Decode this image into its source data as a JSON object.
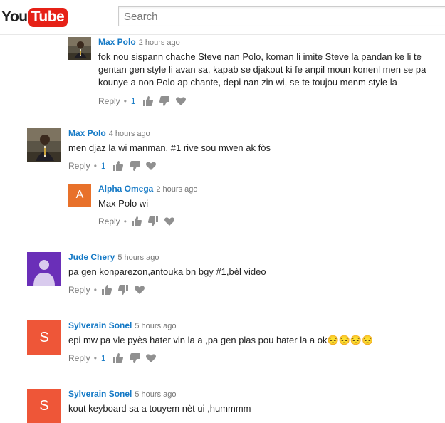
{
  "header": {
    "logo_you": "You",
    "logo_tube": "Tube",
    "search_placeholder": "Search"
  },
  "comments": [
    {
      "author": "Max Polo",
      "time": "2 hours ago",
      "lines": [
        "fok nou sispann chache Steve nan Polo, koman li imite Steve la pandan ke li te",
        "gentan gen style li avan sa, kapab se djakout ki fe anpil moun konenl men se pa",
        "kounye a non Polo ap chante, depi nan zin wi, se te toujou menm style la"
      ],
      "reply_label": "Reply",
      "like_count": "1",
      "reply_level": 1
    },
    {
      "author": "Max Polo",
      "time": "4 hours ago",
      "lines": [
        "men djaz la wi manman, #1 rive sou mwen ak fòs"
      ],
      "reply_label": "Reply",
      "like_count": "1",
      "reply_level": 0
    },
    {
      "author": "Alpha Omega",
      "time": "2 hours ago",
      "lines": [
        "Max Polo wi"
      ],
      "reply_label": "Reply",
      "like_count": "",
      "reply_level": 1,
      "avatar_letter": "A",
      "avatar_color": "#e8712a"
    },
    {
      "author": "Jude Chery",
      "time": "5 hours ago",
      "lines": [
        "pa gen konparezon,antouka bn bgy #1,bèl video"
      ],
      "reply_label": "Reply",
      "like_count": "",
      "reply_level": 0,
      "avatar_color": "#6a2fb8"
    },
    {
      "author": "Sylverain Sonel",
      "time": "5 hours ago",
      "lines": [
        "epi mw pa vle pyès hater vin la a ,pa gen plas pou hater la a ok😔😔😔😔"
      ],
      "reply_label": "Reply",
      "like_count": "1",
      "reply_level": 0,
      "avatar_letter": "S",
      "avatar_color": "#ee5638"
    },
    {
      "author": "Sylverain Sonel",
      "time": "5 hours ago",
      "lines": [
        "kout keyboard sa a touyem nèt ui ,hummmm"
      ],
      "reply_label": "",
      "like_count": "",
      "reply_level": 0,
      "avatar_letter": "S",
      "avatar_color": "#ee5638"
    }
  ],
  "icons": {
    "thumb_up": "thumbs-up-icon",
    "thumb_down": "thumbs-down-icon",
    "heart": "heart-icon"
  },
  "colors": {
    "author_link": "#167ac6",
    "youtube_red": "#e62117"
  }
}
